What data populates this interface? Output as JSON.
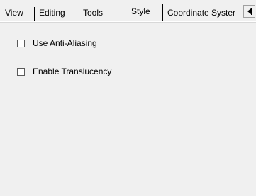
{
  "tabs": [
    {
      "label": "View",
      "active": false
    },
    {
      "label": "Editing",
      "active": false
    },
    {
      "label": "Tools",
      "active": false
    },
    {
      "label": "Style",
      "active": true
    },
    {
      "label": "Coordinate Syster",
      "active": false
    }
  ],
  "options": {
    "anti_aliasing": {
      "label": "Use Anti-Aliasing",
      "checked": false
    },
    "translucency": {
      "label": "Enable Translucency",
      "checked": false
    }
  },
  "icons": {
    "tab_scroll": "left-arrow-icon"
  }
}
